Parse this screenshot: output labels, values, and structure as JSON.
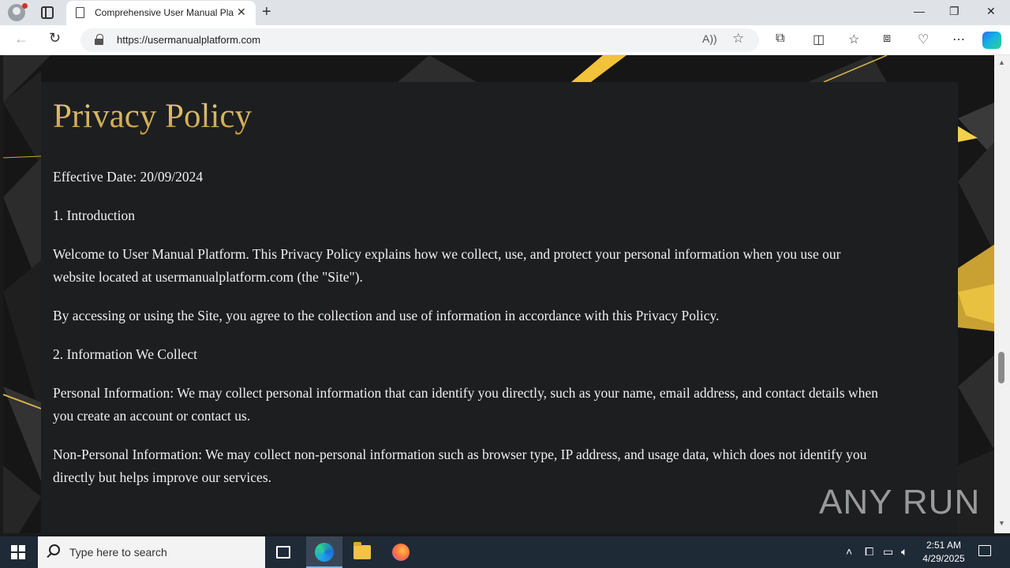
{
  "browser": {
    "tab_title": "Comprehensive User Manual Platform",
    "tab_close": "✕",
    "new_tab": "+",
    "url": "https://usermanualplatform.com",
    "window_controls": {
      "minimize": "—",
      "restore": "❐",
      "close": "✕"
    }
  },
  "page": {
    "heading": "Privacy Policy",
    "paragraphs": [
      "Effective Date: 20/09/2024",
      "1. Introduction",
      "Welcome to User Manual Platform. This Privacy Policy explains how we collect, use, and protect your personal information when you use our website located at usermanualplatform.com (the \"Site\").",
      "By accessing or using the Site, you agree to the collection and use of information in accordance with this Privacy Policy.",
      "2. Information We Collect",
      "Personal Information: We may collect personal information that can identify you directly, such as your name, email address, and contact details when you create an account or contact us.",
      "Non-Personal Information: We may collect non-personal information such as browser type, IP address, and usage data, which does not identify you directly but helps improve our services."
    ]
  },
  "watermark": "ANY RUN",
  "taskbar": {
    "search_placeholder": "Type here to search",
    "time": "2:51 AM",
    "date": "4/29/2025"
  },
  "colors": {
    "heading_gold": "#d4b262",
    "panel_bg": "#1d1e20",
    "accent_gold": "#f5c518"
  },
  "icons": [
    "profile-icon",
    "tab-actions-icon",
    "page-icon",
    "back-icon",
    "reload-icon",
    "lock-icon",
    "read-aloud-icon",
    "favorite-star-icon",
    "extensions-icon",
    "split-screen-icon",
    "favorites-icon",
    "collections-icon",
    "browser-essentials-icon",
    "more-icon",
    "copilot-icon",
    "windows-start-icon",
    "search-icon",
    "task-view-icon",
    "edge-icon",
    "file-explorer-icon",
    "firefox-icon",
    "chevron-up-icon",
    "meet-icon",
    "network-icon",
    "volume-icon",
    "notification-icon"
  ]
}
